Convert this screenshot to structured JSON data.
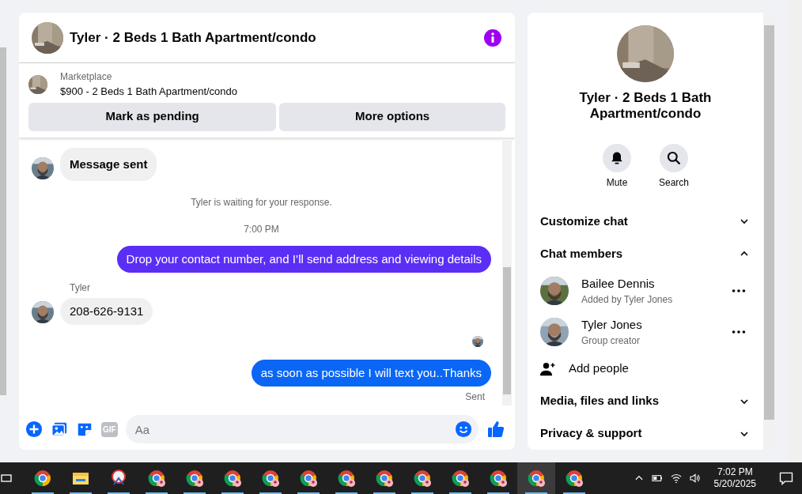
{
  "conversation": {
    "title": "Tyler · 2 Beds 1 Bath Apartment/condo"
  },
  "listing": {
    "source": "Marketplace",
    "title": "$900 - 2 Beds 1 Bath Apartment/condo"
  },
  "listing_actions": [
    "Mark as pending",
    "More options"
  ],
  "messages": [
    {
      "kind": "incoming",
      "text": "Message sent"
    },
    {
      "kind": "notice",
      "text": "Tyler is waiting for your response."
    },
    {
      "kind": "time",
      "text": "7:00 PM"
    },
    {
      "kind": "outgoing",
      "text": "Drop your contact number, and I’ll send address and viewing details",
      "color": "#5b2ef6"
    },
    {
      "kind": "incoming",
      "sender": "Tyler",
      "text": "208-626-9131"
    },
    {
      "kind": "seen"
    },
    {
      "kind": "outgoing",
      "text": "as soon as possible I will text you..Thanks",
      "color": "#0a66f5",
      "status": "Sent"
    }
  ],
  "composer": {
    "gif": "GIF",
    "placeholder": "Aa"
  },
  "sidebar": {
    "title": "Tyler · 2 Beds 1 Bath Apartment/condo",
    "actions": [
      "Mute",
      "Search"
    ],
    "sections": [
      {
        "label": "Customize chat",
        "expanded": false
      },
      {
        "label": "Chat members",
        "expanded": true,
        "members": [
          {
            "name": "Bailee Dennis",
            "role": "Added by Tyler Jones"
          },
          {
            "name": "Tyler Jones",
            "role": "Group creator"
          }
        ],
        "add": "Add people"
      },
      {
        "label": "Media, files and links",
        "expanded": false
      },
      {
        "label": "Privacy & support",
        "expanded": false
      }
    ]
  },
  "taskbar": {
    "apps": [
      {
        "kind": "browser",
        "selected": false
      },
      {
        "kind": "folder",
        "selected": false
      },
      {
        "kind": "snip",
        "selected": false
      },
      {
        "kind": "profile",
        "selected": false
      },
      {
        "kind": "profile",
        "selected": false
      },
      {
        "kind": "profile",
        "selected": false
      },
      {
        "kind": "profile",
        "selected": false
      },
      {
        "kind": "profile",
        "selected": false
      },
      {
        "kind": "profile",
        "selected": false
      },
      {
        "kind": "profile",
        "selected": false
      },
      {
        "kind": "profile",
        "selected": false
      },
      {
        "kind": "profile",
        "selected": false
      },
      {
        "kind": "profile",
        "selected": false
      },
      {
        "kind": "profile",
        "selected": true
      },
      {
        "kind": "profile",
        "selected": false
      }
    ],
    "time": "7:02 PM",
    "date": "5/20/2025"
  }
}
